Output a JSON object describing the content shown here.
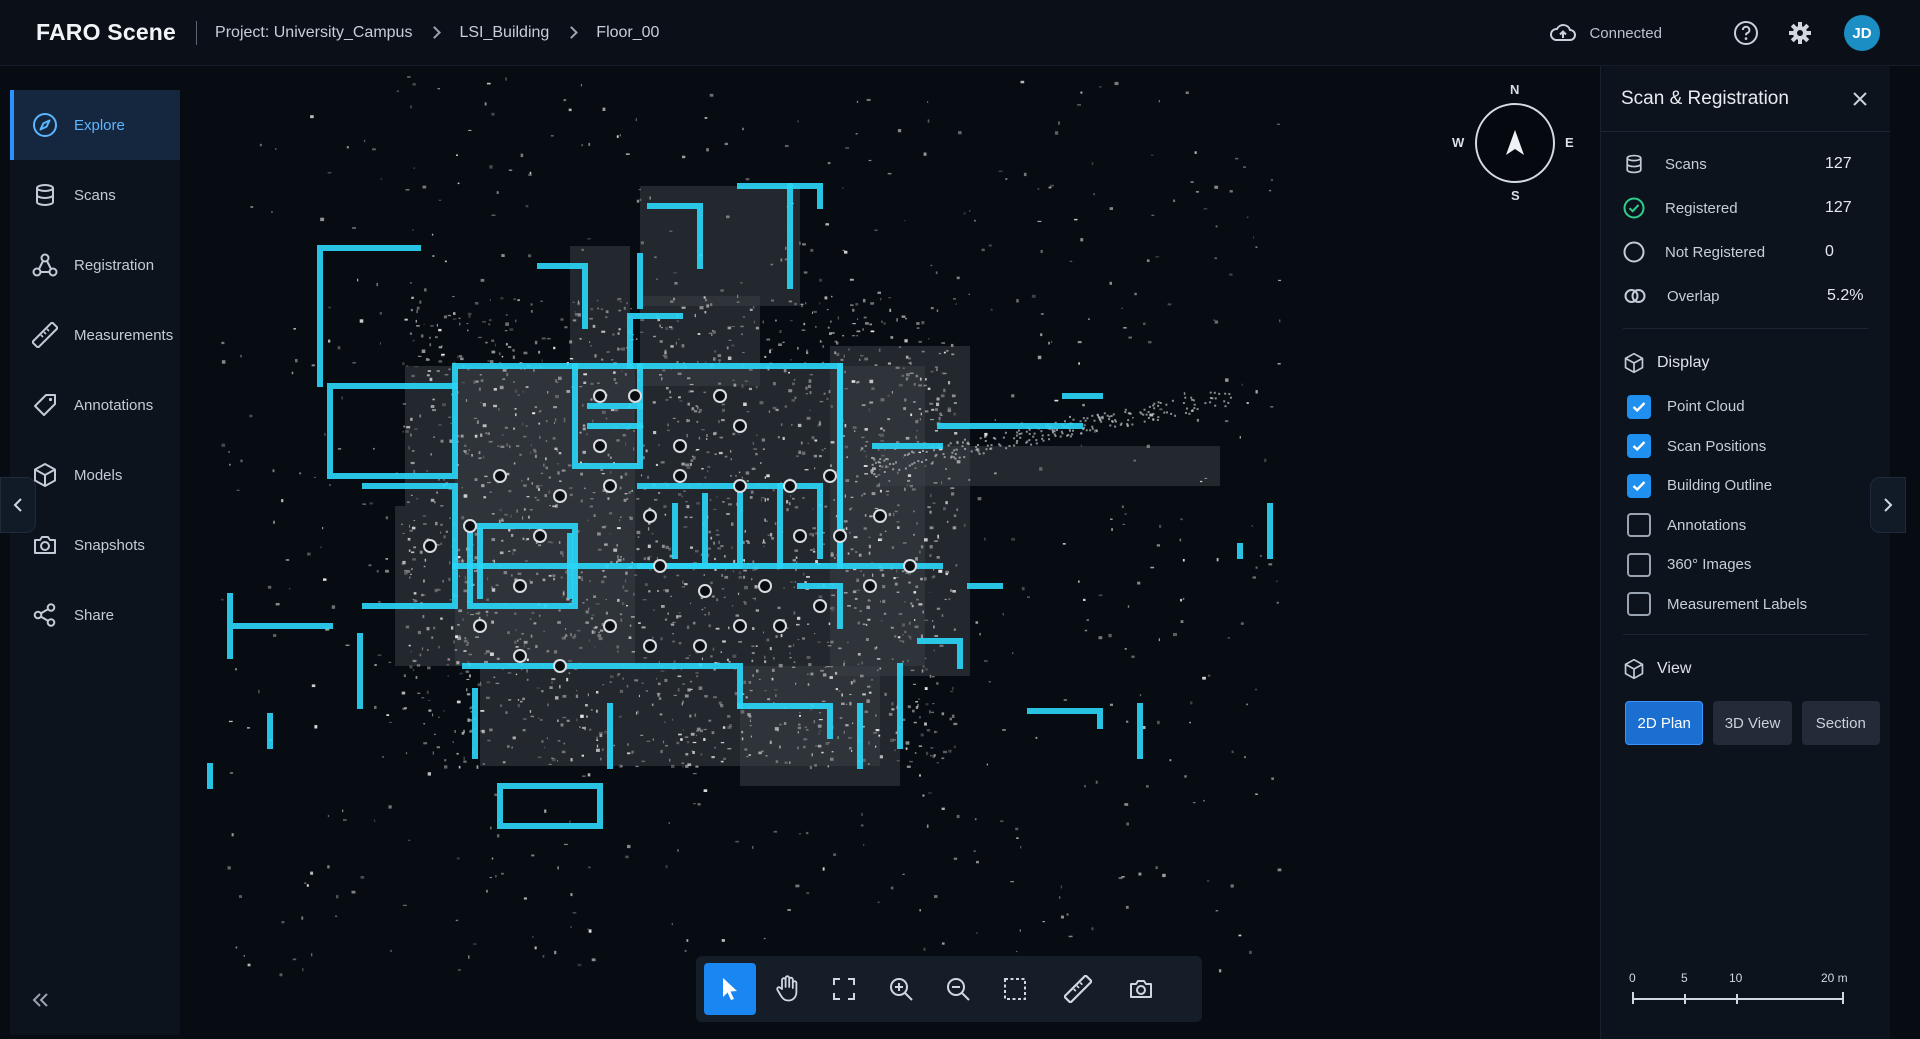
{
  "header": {
    "brand": "FARO Scene",
    "breadcrumb": [
      "Project: University_Campus",
      "LSI_Building",
      "Floor_00"
    ],
    "status": "Connected",
    "user_initials": "JD"
  },
  "sidebar": {
    "items": [
      {
        "label": "Explore",
        "icon": "compass-icon",
        "active": true
      },
      {
        "label": "Scans",
        "icon": "database-icon"
      },
      {
        "label": "Registration",
        "icon": "registration-icon"
      },
      {
        "label": "Measurements",
        "icon": "ruler-icon"
      },
      {
        "label": "Annotations",
        "icon": "tag-icon"
      },
      {
        "label": "Models",
        "icon": "cube-icon"
      },
      {
        "label": "Snapshots",
        "icon": "camera-icon"
      },
      {
        "label": "Share",
        "icon": "share-icon"
      }
    ]
  },
  "compass": {
    "n": "N",
    "s": "S",
    "e": "E",
    "w": "W"
  },
  "panel": {
    "title": "Scan & Registration",
    "stats": [
      {
        "label": "Scans",
        "value": "127",
        "icon": "database-icon"
      },
      {
        "label": "Registered",
        "value": "127",
        "icon": "check-circle-icon"
      },
      {
        "label": "Not Registered",
        "value": "0",
        "icon": "circle-icon"
      },
      {
        "label": "Overlap",
        "value": "5.2%",
        "icon": "overlap-icon"
      }
    ],
    "display_title": "Display",
    "display_options": [
      {
        "label": "Point Cloud",
        "checked": true
      },
      {
        "label": "Scan Positions",
        "checked": true
      },
      {
        "label": "Building Outline",
        "checked": true
      },
      {
        "label": "Annotations",
        "checked": false
      },
      {
        "label": "360° Images",
        "checked": false
      },
      {
        "label": "Measurement Labels",
        "checked": false
      }
    ],
    "view_title": "View",
    "view_buttons": [
      {
        "label": "2D Plan",
        "active": true
      },
      {
        "label": "3D View",
        "active": false
      },
      {
        "label": "Section",
        "active": false
      }
    ],
    "scale": {
      "ticks": [
        "0",
        "5",
        "10",
        "20 m"
      ]
    }
  },
  "toolbar": {
    "tools": [
      "select-tool",
      "pan-tool",
      "fit-view-tool",
      "zoom-in-tool",
      "zoom-out-tool",
      "box-select-tool",
      "measure-tool",
      "snapshot-tool"
    ],
    "active": "select-tool"
  },
  "colors": {
    "accent": "#1a86f2",
    "outline": "#2bd4f5",
    "background": "#05070c"
  }
}
